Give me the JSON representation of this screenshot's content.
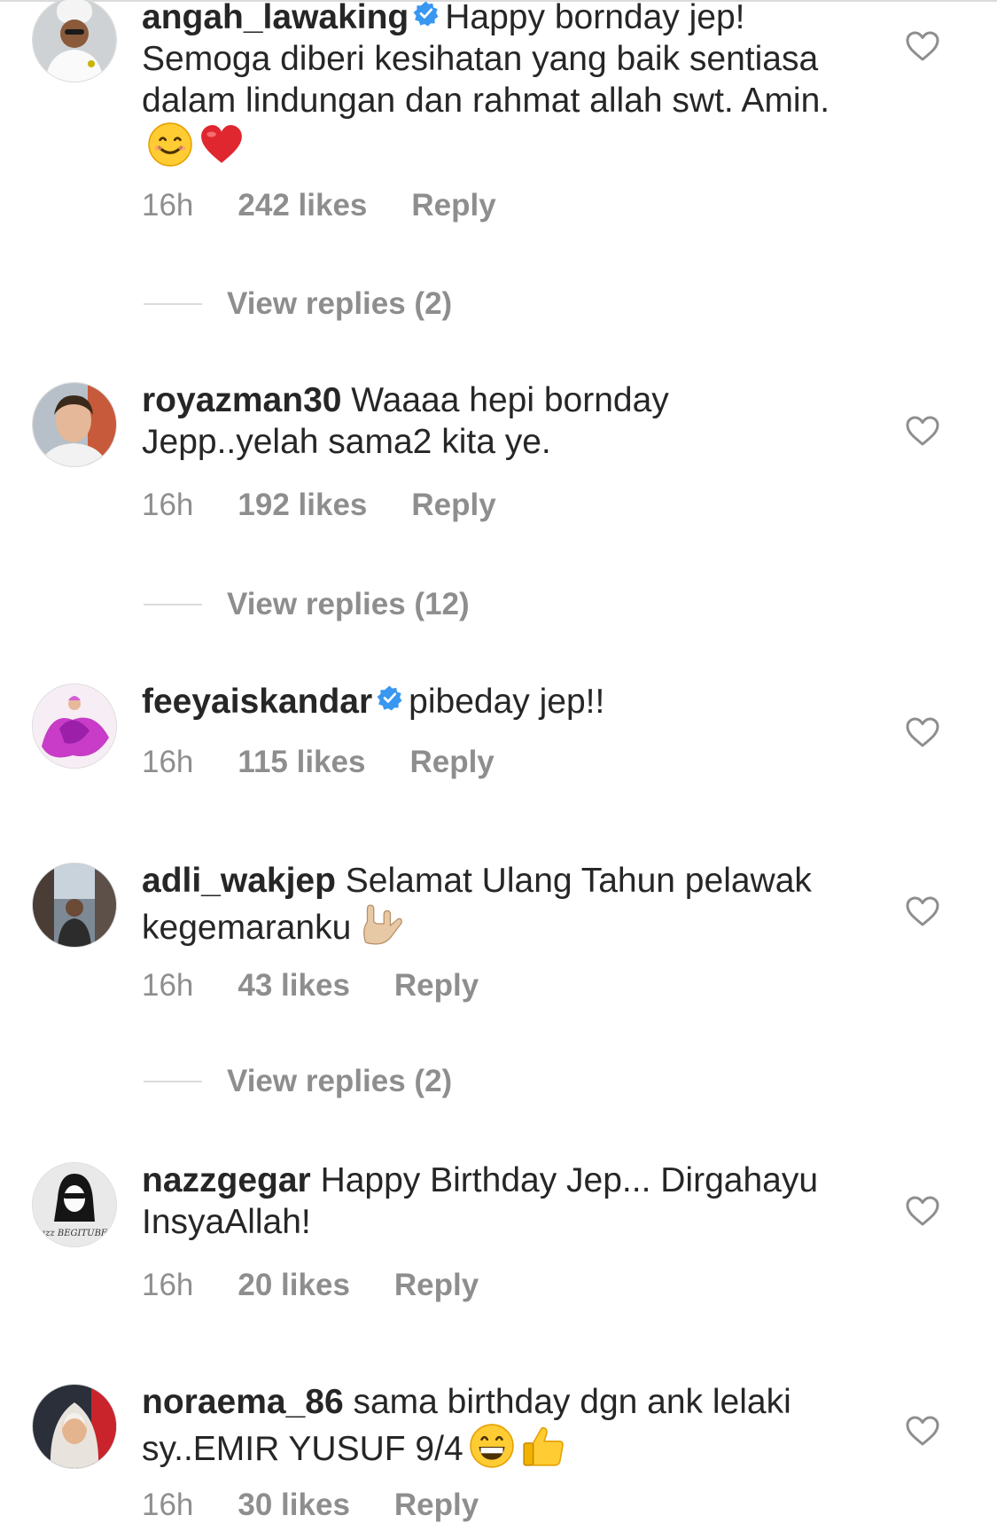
{
  "comments": [
    {
      "username": "angah_lawaking",
      "verified": true,
      "text": "Happy bornday jep! Semoga  diberi kesihatan yang baik sentiasa dalam lindungan dan rahmat allah swt. Amin.",
      "emojis": [
        "smiling-face-emoji",
        "red-heart-emoji"
      ],
      "time": "16h",
      "likes": "242 likes",
      "reply": "Reply",
      "view_replies": "View replies (2)"
    },
    {
      "username": "royazman30",
      "verified": false,
      "text": "Waaaa hepi bornday Jepp..yelah sama2 kita ye.",
      "emojis": [],
      "time": "16h",
      "likes": "192 likes",
      "reply": "Reply",
      "view_replies": "View replies (12)"
    },
    {
      "username": "feeyaiskandar",
      "verified": true,
      "text": "pibeday jep!!",
      "emojis": [],
      "time": "16h",
      "likes": "115 likes",
      "reply": "Reply"
    },
    {
      "username": "adli_wakjep",
      "verified": false,
      "text": "Selamat Ulang Tahun pelawak kegemaranku",
      "emojis": [
        "rock-on-hand-emoji"
      ],
      "time": "16h",
      "likes": "43 likes",
      "reply": "Reply",
      "view_replies": "View replies (2)"
    },
    {
      "username": "nazzgegar",
      "verified": false,
      "text": "Happy Birthday Jep... Dirgahayu InsyaAllah!",
      "emojis": [],
      "time": "16h",
      "likes": "20 likes",
      "reply": "Reply"
    },
    {
      "username": "noraema_86",
      "verified": false,
      "text": "sama birthday dgn ank lelaki sy..EMIR YUSUF 9/4",
      "emojis": [
        "grinning-face-emoji",
        "thumbs-up-emoji"
      ],
      "time": "16h",
      "likes": "30 likes",
      "reply": "Reply"
    }
  ],
  "avatar_logo_text": "Dj Nazz BEGITUBEGINI",
  "colors": {
    "text": "#262626",
    "secondary": "#8e8e8e",
    "verified_badge": "#3897f0",
    "divider": "#dbdbdb"
  }
}
